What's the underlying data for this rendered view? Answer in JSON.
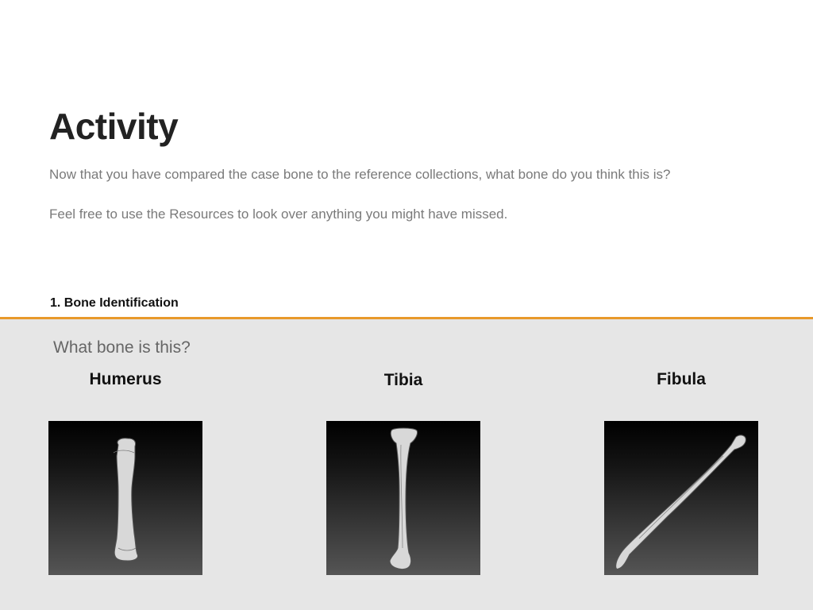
{
  "activity": {
    "title": "Activity",
    "intro": "Now that you have compared the case bone to the reference collections, what bone do you think this is?",
    "resources_note": "Feel free to use the Resources to look over anything you might have missed."
  },
  "section": {
    "label": "1. Bone Identification",
    "accent_color": "#e8992a",
    "background_color": "#e6e6e6"
  },
  "question": {
    "prompt": "What bone is this?",
    "options": [
      {
        "label": "Humerus",
        "icon": "humerus-bone-icon"
      },
      {
        "label": "Tibia",
        "icon": "tibia-bone-icon"
      },
      {
        "label": "Fibula",
        "icon": "fibula-bone-icon"
      }
    ]
  }
}
